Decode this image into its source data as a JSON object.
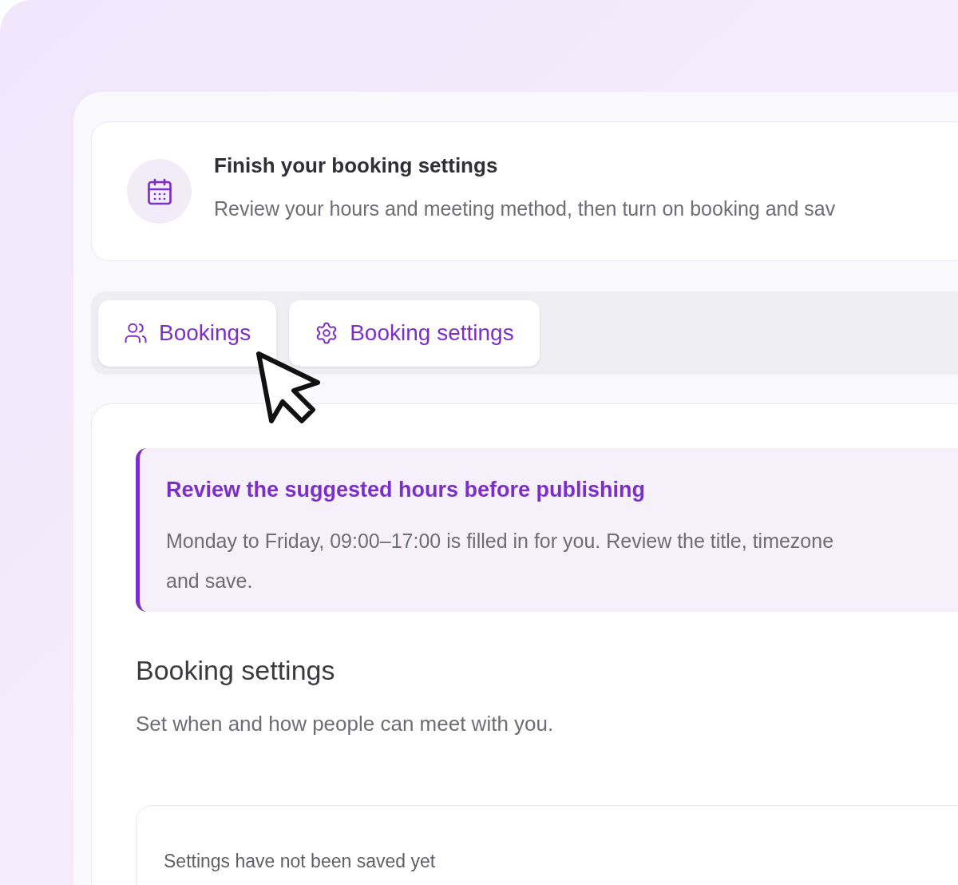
{
  "notice": {
    "title": "Finish your booking settings",
    "text": "Review your hours and meeting method, then turn on booking and sav"
  },
  "tabs": [
    {
      "label": "Bookings",
      "kind": "people",
      "selected": false
    },
    {
      "label": "Booking settings",
      "kind": "gear",
      "selected": false
    }
  ],
  "callout": {
    "title": "Review the suggested hours before publishing",
    "text": "Monday to Friday, 09:00–17:00 is filled in for you. Review the title, timezone\nand save."
  },
  "section": {
    "title": "Booking settings",
    "subtitle": "Set when and how people can meet with you."
  },
  "status_card": {
    "text": "Settings have not been saved yet"
  }
}
